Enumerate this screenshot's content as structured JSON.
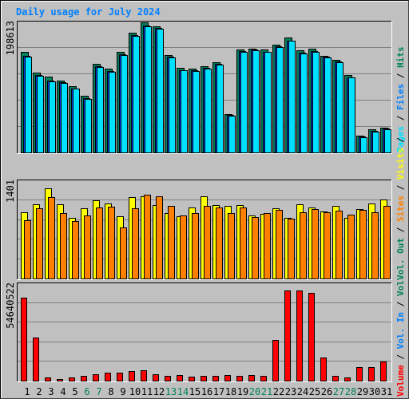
{
  "title": "Daily usage for July 2024",
  "colors": {
    "hits": "#00805c",
    "files": "#0040ff",
    "pages": "#00e0ff",
    "visits": "#ffff00",
    "sites": "#ff8000",
    "volume": "#ff0000",
    "vol_in": "#0080ff",
    "vol_out": "#00805c",
    "weekend_label": "#00805c",
    "weekday_label": "#000000",
    "title": "#0080ff",
    "grid": "#808080",
    "background": "#c0c0c0"
  },
  "legends": {
    "top": [
      {
        "text": "Pages",
        "color": "#00e0ff"
      },
      {
        "text": " / ",
        "color": "#000000"
      },
      {
        "text": "Files",
        "color": "#0080ff"
      },
      {
        "text": " / ",
        "color": "#000000"
      },
      {
        "text": "Hits",
        "color": "#00805c"
      }
    ],
    "middle": [
      {
        "text": "Vol. Out",
        "color": "#00805c"
      },
      {
        "text": " / ",
        "color": "#000000"
      },
      {
        "text": "Sites",
        "color": "#ff8000"
      },
      {
        "text": " / ",
        "color": "#000000"
      },
      {
        "text": "Visits",
        "color": "#ffff00"
      },
      {
        "text": " / ",
        "color": "#000000"
      }
    ],
    "bottom": [
      {
        "text": "Volume",
        "color": "#ff0000"
      },
      {
        "text": " / ",
        "color": "#000000"
      },
      {
        "text": "Vol. In",
        "color": "#0080ff"
      },
      {
        "text": " / ",
        "color": "#000000"
      },
      {
        "text": "Vol.",
        "color": "#00805c"
      }
    ]
  },
  "chart_data": [
    {
      "type": "bar",
      "title": "Daily usage for July 2024",
      "panel": "hits-files-pages",
      "categories": [
        "1",
        "2",
        "3",
        "4",
        "5",
        "6",
        "7",
        "8",
        "9",
        "10",
        "11",
        "12",
        "13",
        "14",
        "15",
        "16",
        "17",
        "18",
        "19",
        "20",
        "21",
        "22",
        "23",
        "24",
        "25",
        "26",
        "27",
        "28",
        "29",
        "30",
        "31"
      ],
      "weekend_days": [
        "6",
        "7",
        "13",
        "14",
        "20",
        "21",
        "27",
        "28"
      ],
      "ymax_label": "198613",
      "ylim": [
        0,
        198613
      ],
      "grid": true,
      "legend": "right",
      "series": [
        {
          "name": "Hits",
          "values": [
            153000,
            122000,
            116000,
            110000,
            101000,
            86000,
            135000,
            128000,
            153000,
            183000,
            198613,
            193000,
            149000,
            129000,
            128000,
            132000,
            138000,
            59000,
            157000,
            159000,
            157000,
            164000,
            175000,
            156000,
            158000,
            148000,
            141000,
            118000,
            25000,
            35000,
            38000
          ]
        },
        {
          "name": "Files",
          "values": [
            148000,
            118000,
            110000,
            107000,
            98000,
            83000,
            131000,
            124000,
            150000,
            179000,
            194000,
            190000,
            146000,
            126000,
            125000,
            129000,
            135000,
            57000,
            155000,
            157000,
            154000,
            162000,
            171000,
            152000,
            155000,
            146000,
            139000,
            115000,
            24000,
            33000,
            36000
          ]
        },
        {
          "name": "Pages",
          "values": [
            146000,
            117000,
            108000,
            106000,
            97000,
            82000,
            130000,
            123000,
            149000,
            178000,
            193000,
            189000,
            145000,
            125000,
            124000,
            128000,
            134000,
            56000,
            154000,
            156000,
            153000,
            161000,
            170000,
            151000,
            154000,
            145000,
            138000,
            114000,
            23000,
            32000,
            35000
          ]
        }
      ]
    },
    {
      "type": "bar",
      "panel": "visits-sites",
      "categories": [
        "1",
        "2",
        "3",
        "4",
        "5",
        "6",
        "7",
        "8",
        "9",
        "10",
        "11",
        "12",
        "13",
        "14",
        "15",
        "16",
        "17",
        "18",
        "19",
        "20",
        "21",
        "22",
        "23",
        "24",
        "25",
        "26",
        "27",
        "28",
        "29",
        "30",
        "31"
      ],
      "ymax_label": "1401",
      "ylim": [
        0,
        1401
      ],
      "grid": true,
      "series": [
        {
          "name": "Visits",
          "values": [
            1130,
            1270,
            1540,
            1270,
            1040,
            1200,
            1340,
            1280,
            1060,
            1400,
            1410,
            1260,
            1120,
            1060,
            1220,
            1410,
            1260,
            1240,
            1260,
            1080,
            1110,
            1200,
            1040,
            1270,
            1220,
            1150,
            1240,
            1040,
            1190,
            1290,
            1350
          ]
        },
        {
          "name": "Sites",
          "values": [
            1000,
            1200,
            1390,
            1120,
            980,
            1080,
            1210,
            1230,
            880,
            1200,
            1440,
            1410,
            1240,
            1080,
            1120,
            1240,
            1220,
            1120,
            1220,
            1050,
            1120,
            1170,
            1030,
            1140,
            1190,
            1130,
            1160,
            1100,
            1170,
            1140,
            1250
          ]
        }
      ]
    },
    {
      "type": "bar",
      "panel": "volume",
      "categories": [
        "1",
        "2",
        "3",
        "4",
        "5",
        "6",
        "7",
        "8",
        "9",
        "10",
        "11",
        "12",
        "13",
        "14",
        "15",
        "16",
        "17",
        "18",
        "19",
        "20",
        "21",
        "22",
        "23",
        "24",
        "25",
        "26",
        "27",
        "28",
        "29",
        "30",
        "31"
      ],
      "ymax_label": "54640522",
      "ylim": [
        0,
        54640522
      ],
      "grid": true,
      "series": [
        {
          "name": "Volume",
          "values": [
            50500000,
            26000000,
            1700000,
            1000000,
            1700000,
            2700000,
            3700000,
            4700000,
            4700000,
            5800000,
            6200000,
            4000000,
            2700000,
            3400000,
            2300000,
            2700000,
            2700000,
            3400000,
            2700000,
            3400000,
            2700000,
            24800000,
            54640522,
            54640522,
            53000000,
            14000000,
            2700000,
            1700000,
            8000000,
            8000000,
            11800000
          ]
        }
      ]
    }
  ]
}
